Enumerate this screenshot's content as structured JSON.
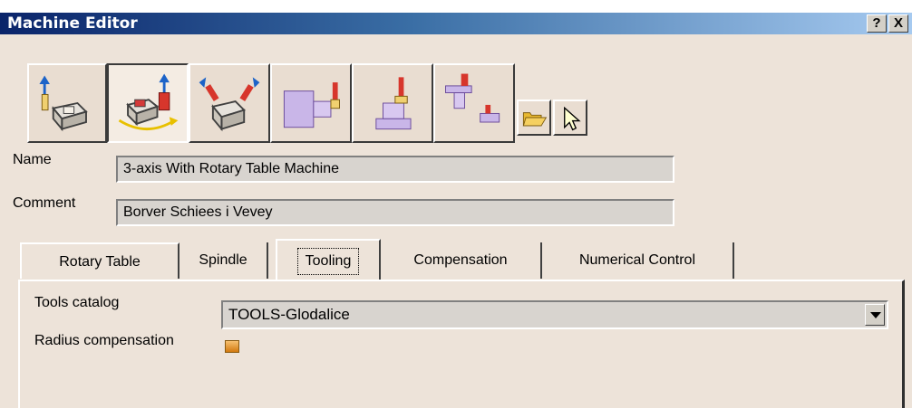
{
  "window": {
    "title": "Machine Editor",
    "help_label": "?",
    "close_label": "X"
  },
  "toolbar": {
    "icons": [
      "3-axis-machine-icon",
      "3-axis-rotary-table-machine-icon",
      "5-axis-machine-icon",
      "horizontal-lathe-machine-icon",
      "vertical-lathe-machine-icon",
      "multi-slide-lathe-machine-icon",
      "open-folder-icon",
      "select-arrow-icon"
    ],
    "active_index": 1
  },
  "form": {
    "name_label": "Name",
    "name_value": "3-axis With Rotary Table Machine",
    "comment_label": "Comment",
    "comment_value": "Borver Schiees i Vevey"
  },
  "tabs": [
    {
      "label": "Rotary Table"
    },
    {
      "label": "Spindle"
    },
    {
      "label": "Tooling"
    },
    {
      "label": "Compensation"
    },
    {
      "label": "Numerical Control"
    }
  ],
  "active_tab": "Tooling",
  "tooling": {
    "tools_catalog_label": "Tools catalog",
    "tools_catalog_value": "TOOLS-Glodalice",
    "radius_comp_label": "Radius compensation",
    "radius_comp_checked": true
  },
  "colors": {
    "title_start": "#0a246a",
    "title_end": "#a6caf0",
    "dialog_bg": "#ede3d9",
    "checkbox": "#e08a20"
  }
}
